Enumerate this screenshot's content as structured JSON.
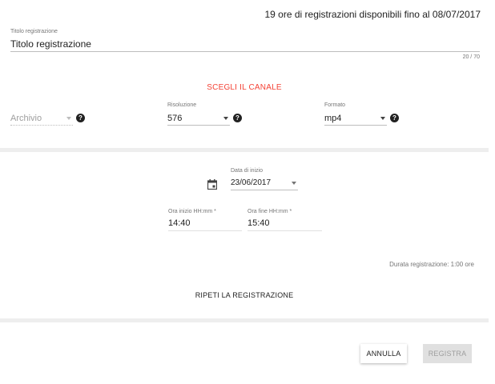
{
  "header": {
    "hours_available": "19 ore di registrazioni disponibili fino al 08/07/2017"
  },
  "title_field": {
    "caption": "Titolo registrazione",
    "value": "Titolo registrazione",
    "counter": "20 / 70"
  },
  "channel": {
    "label": "SCEGLI IL CANALE"
  },
  "archive": {
    "value": "Archivio"
  },
  "resolution": {
    "caption": "Risoluzione",
    "value": "576"
  },
  "format": {
    "caption": "Formato",
    "value": "mp4"
  },
  "help_glyph": "?",
  "date": {
    "caption": "Data di inizio",
    "value": "23/06/2017"
  },
  "start_time": {
    "caption": "Ora inizio HH:mm *",
    "value": "14:40"
  },
  "end_time": {
    "caption": "Ora fine HH:mm *",
    "value": "15:40"
  },
  "duration": "Durata registrazione: 1:00 ore",
  "repeat_label": "RIPETI LA REGISTRAZIONE",
  "buttons": {
    "cancel": "ANNULLA",
    "record": "REGISTRA"
  },
  "colors": {
    "accent": "#f44336",
    "divider": "#eeeeee",
    "disabled_button": "#e0e0e0"
  }
}
